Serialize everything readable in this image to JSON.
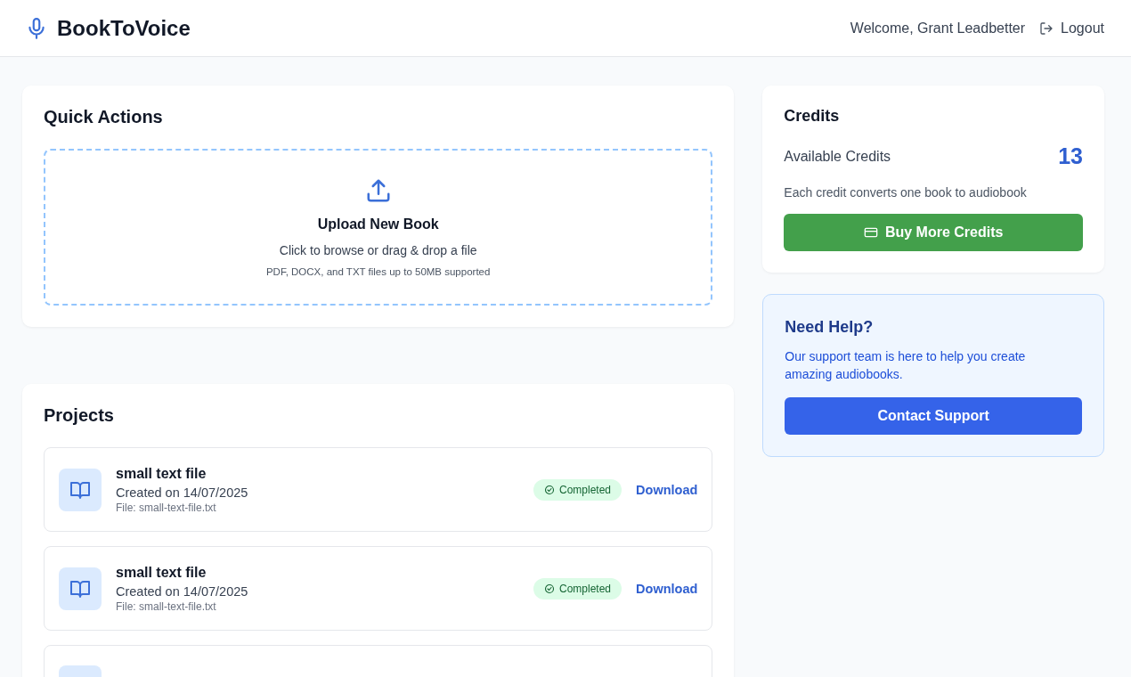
{
  "header": {
    "brand": "BookToVoice",
    "welcome": "Welcome, Grant Leadbetter",
    "logout": "Logout"
  },
  "quick_actions": {
    "title": "Quick Actions",
    "upload": {
      "title": "Upload New Book",
      "hint": "Click to browse or drag & drop a file",
      "formats": "PDF, DOCX, and TXT files up to 50MB supported"
    }
  },
  "projects": {
    "title": "Projects",
    "items": [
      {
        "kind": "completed",
        "name": "small text file",
        "created": "Created on 14/07/2025",
        "file": "File: small-text-file.txt",
        "status_label": "Completed",
        "action": "Download"
      },
      {
        "kind": "completed",
        "name": "small text file",
        "created": "Created on 14/07/2025",
        "file": "File: small-text-file.txt",
        "status_label": "Completed",
        "action": "Download"
      },
      {
        "kind": "cut"
      }
    ]
  },
  "credits": {
    "title": "Credits",
    "label": "Available Credits",
    "count": "13",
    "note": "Each credit converts one book to audiobook",
    "button": "Buy More Credits"
  },
  "help": {
    "title": "Need Help?",
    "text": "Our support team is here to help you create amazing audiobooks.",
    "button": "Contact Support"
  }
}
